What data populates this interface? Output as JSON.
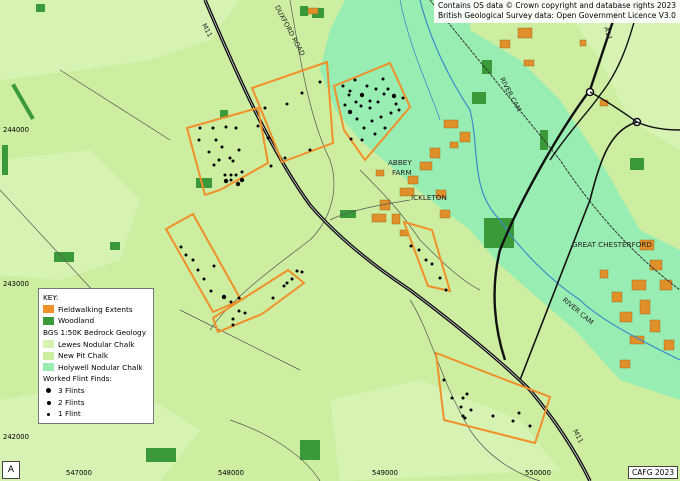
{
  "attribution": [
    "Contains OS data © Crown copyright and database rights 2023",
    "British Geological Survey data: Open Government Licence V3.0"
  ],
  "panel_label": "A",
  "credit": "CAFG 2023",
  "key": {
    "title": "KEY:",
    "fieldwalking": "Fieldwalking Extents",
    "woodland": "Woodland",
    "geology_title": "BGS 1:50K Bedrock Geology",
    "lewes": "Lewes Nodular Chalk",
    "newpit": "New Pit Chalk",
    "holywell": "Holywell Nodular Chalk",
    "finds_title": "Worked Flint Finds:",
    "f3": "3 Flints",
    "f2": "2 Flints",
    "f1": "1 Flint"
  },
  "colors": {
    "fieldwalking": "#f0902a",
    "woodland": "#3a9a3a",
    "lewes": "#d6f3b4",
    "newpit": "#cdeea0",
    "holywell": "#98edb2",
    "buildings": "#e0902a"
  },
  "grid": {
    "eastings": [
      "547000",
      "548000",
      "549000",
      "550000"
    ],
    "northings": [
      "244000",
      "243000",
      "242000"
    ]
  },
  "places": {
    "abbey": "ABBEY",
    "farm": "FARM",
    "ickleton": "ICKLETON",
    "great_chesterford": "GREAT CHESTERFORD"
  },
  "roads": {
    "m11_top": "M11",
    "m11_bottom": "M11",
    "duxford_road": "DUXFORD ROAD",
    "river_cam_1": "RIVER CAM",
    "river_cam_2": "RIVER CAM",
    "a11": "A11"
  }
}
